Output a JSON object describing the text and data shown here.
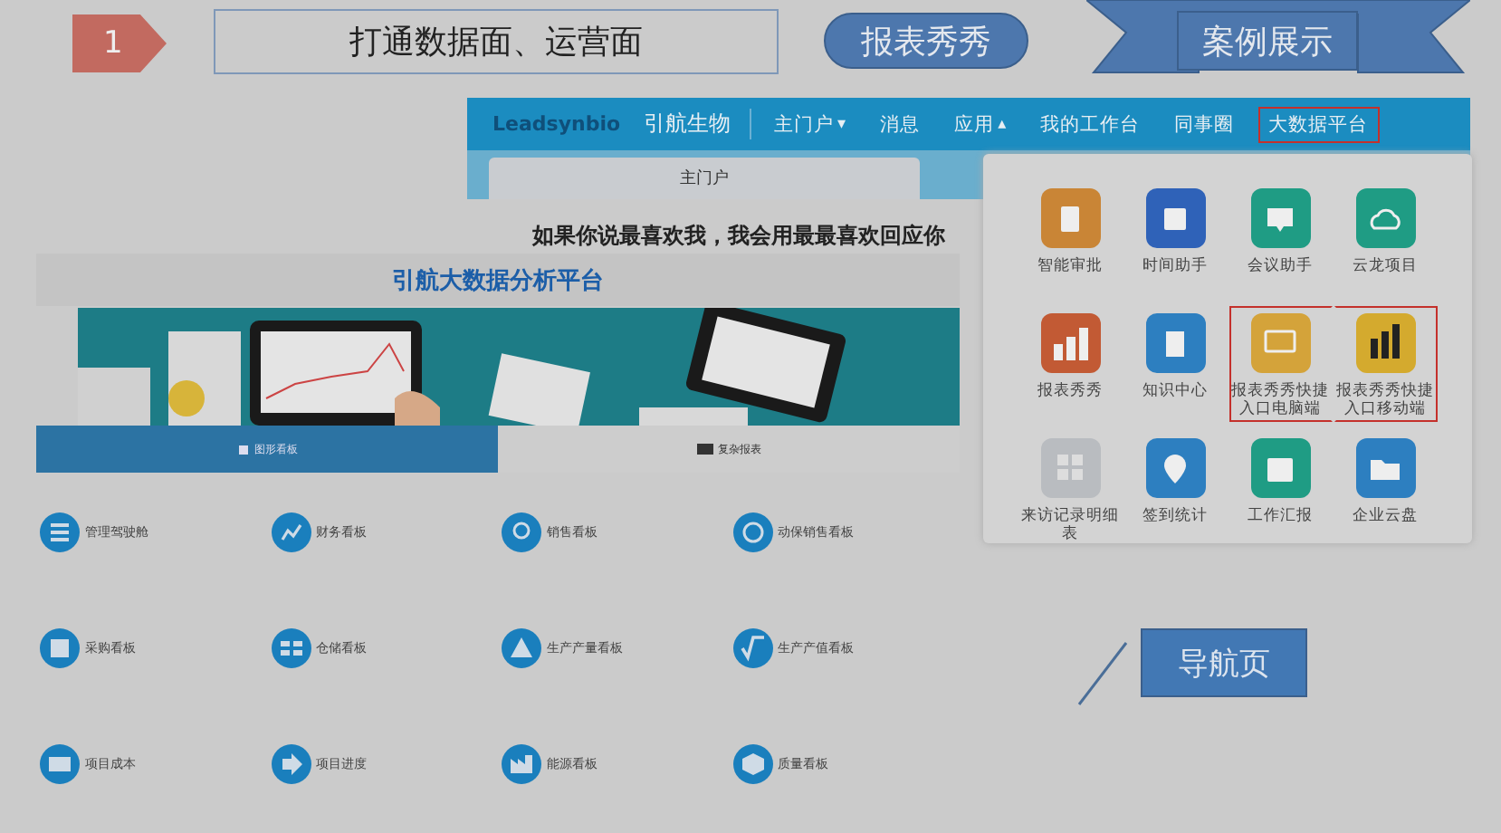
{
  "slide": {
    "step": "1",
    "title": "打通数据面、运营面",
    "tag": "报表秀秀",
    "ribbon": "案例展示",
    "callout": "导航页"
  },
  "nav": {
    "logo": "Leadsynbio",
    "brand": "引航生物",
    "items": [
      {
        "label": "主门户",
        "caret": "▾",
        "highlighted": false
      },
      {
        "label": "消息",
        "highlighted": false
      },
      {
        "label": "应用",
        "caret": "▴",
        "highlighted": false
      },
      {
        "label": "我的工作台",
        "highlighted": false
      },
      {
        "label": "同事圈",
        "highlighted": false
      },
      {
        "label": "大数据平台",
        "highlighted": true
      }
    ]
  },
  "portal_tab": "主门户",
  "dashboard": {
    "slogan": "如果你说最喜欢我，我会用最最喜欢回应你",
    "title": "引航大数据分析平台",
    "tabs": [
      {
        "label": "图形看板",
        "selected": true
      },
      {
        "label": "复杂报表",
        "selected": false
      }
    ],
    "tiles": [
      {
        "label": "管理驾驶舱"
      },
      {
        "label": "财务看板"
      },
      {
        "label": "销售看板"
      },
      {
        "label": "动保销售看板"
      },
      {
        "label": "采购看板"
      },
      {
        "label": "仓储看板"
      },
      {
        "label": "生产产量看板"
      },
      {
        "label": "生产产值看板"
      },
      {
        "label": "项目成本"
      },
      {
        "label": "项目进度"
      },
      {
        "label": "能源看板"
      },
      {
        "label": "质量看板"
      }
    ]
  },
  "apps": [
    {
      "label": "智能审批",
      "color": "#c98536",
      "highlighted": false
    },
    {
      "label": "时间助手",
      "color": "#2f62b8",
      "highlighted": false
    },
    {
      "label": "会议助手",
      "color": "#1f9c84",
      "highlighted": false
    },
    {
      "label": "云龙项目",
      "color": "#1f9c84",
      "highlighted": false
    },
    {
      "label": "报表秀秀",
      "color": "#c25a34",
      "highlighted": false
    },
    {
      "label": "知识中心",
      "color": "#2d7fc0",
      "highlighted": false
    },
    {
      "label": "报表秀秀快捷入口电脑端",
      "color": "#d4a33a",
      "highlighted": true
    },
    {
      "label": "报表秀秀快捷入口移动端",
      "color": "#d4aa2e",
      "highlighted": true
    },
    {
      "label": "来访记录明细表",
      "color": "#b9bcc0",
      "highlighted": false
    },
    {
      "label": "签到统计",
      "color": "#2d7fc0",
      "highlighted": false
    },
    {
      "label": "工作汇报",
      "color": "#1f9c84",
      "highlighted": false
    },
    {
      "label": "企业云盘",
      "color": "#2d7fc0",
      "highlighted": false
    }
  ]
}
